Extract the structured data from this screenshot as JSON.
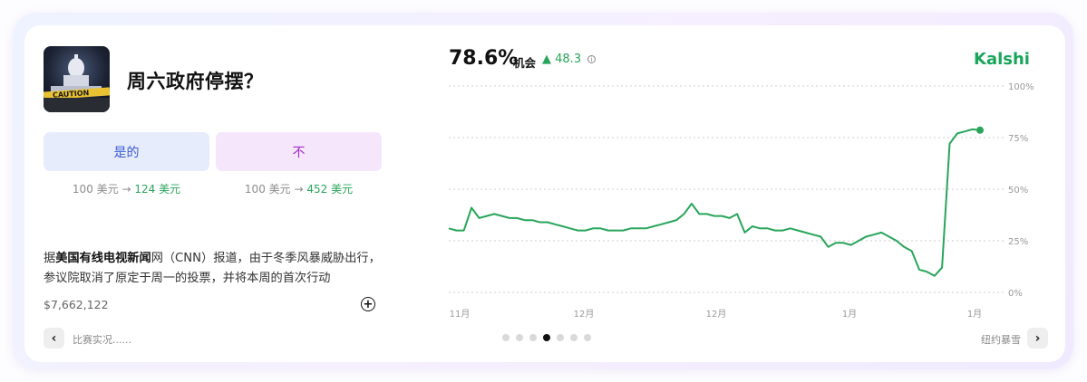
{
  "market": {
    "title": "周六政府停摆？",
    "thumbnail_caption": "CAUTION"
  },
  "buttons": {
    "yes_label": "是的",
    "no_label": "不"
  },
  "payouts": {
    "yes_stake": "100 美元 →",
    "yes_return": "124 美元",
    "no_stake": "100 美元 →",
    "no_return": "452 美元"
  },
  "description": {
    "prefix": "据",
    "source_bold": "美国有线电视新闻",
    "rest": "网（CNN）报道，由于冬季风暴威胁出行，参议院取消了原定于周一的投票，并将本周的首次行动"
  },
  "volume": "$7,662,122",
  "icons": {
    "plus": "plus-circle-icon",
    "prev": "chevron-left-icon",
    "next": "chevron-right-icon",
    "info": "info-icon",
    "delta": "triangle-up-icon"
  },
  "nav": {
    "prev_label": "比赛实况......",
    "next_label": "纽约暴雪",
    "dots_count": 7,
    "active_dot": 3
  },
  "stats": {
    "probability": "78.6%",
    "chance_label": "机会",
    "delta": "48.3"
  },
  "brand": "Kalshi",
  "colors": {
    "accent_green": "#28a55a",
    "yes_bg": "#e6ecfb",
    "yes_text": "#3b5bd6",
    "no_bg": "#f5e6fb",
    "no_text": "#a22fc4"
  },
  "chart_data": {
    "type": "line",
    "title": "",
    "xlabel": "",
    "ylabel": "",
    "ylim": [
      0,
      100
    ],
    "grid": true,
    "y_ticks": [
      "100%",
      "75%",
      "50%",
      "25%",
      "0%"
    ],
    "x_ticks": [
      "11月",
      "12月",
      "12月",
      "1月",
      "1月"
    ],
    "series": [
      {
        "values": [
          31,
          30,
          30,
          41,
          36,
          37,
          38,
          37,
          36,
          36,
          35,
          35,
          34,
          34,
          33,
          32,
          31,
          30,
          30,
          31,
          31,
          30,
          30,
          30,
          31,
          31,
          31,
          32,
          33,
          34,
          35,
          38,
          43,
          38,
          38,
          37,
          37,
          36,
          38,
          29,
          32,
          31,
          31,
          30,
          30,
          31,
          30,
          29,
          28,
          27,
          22,
          24,
          24,
          23,
          25,
          27,
          28,
          29,
          27,
          25,
          22,
          20,
          11,
          10,
          8,
          12,
          72,
          77,
          78,
          79,
          78.6
        ]
      }
    ]
  }
}
